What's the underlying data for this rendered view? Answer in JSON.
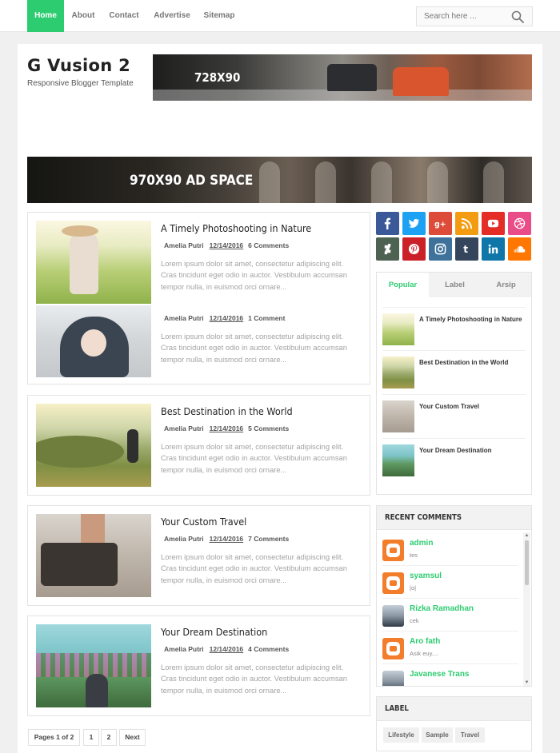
{
  "nav": {
    "items": [
      "Home",
      "About",
      "Contact",
      "Advertise",
      "Sitemap"
    ],
    "active": "Home",
    "search_placeholder": "Search here ..."
  },
  "header": {
    "blog_title": "G Vusion 2",
    "tagline": "Responsive Blogger Template",
    "ad_728": "728X90",
    "ad_970": "970X90 AD SPACE"
  },
  "posts": [
    {
      "title": "A Timely Photoshooting in Nature",
      "author": "Amelia Putri",
      "date": "12/14/2016",
      "comments": "6 Comments",
      "excerpt": "Lorem ipsum dolor sit amet, consectetur adipiscing elit. Cras tincidunt eget odio in auctor. Vestibulum accumsan tempor nulla, in euismod orci ornare...",
      "image": "nature-photoshoot"
    },
    {
      "title": "",
      "author": "Amelia Putri",
      "date": "12/14/2016",
      "comments": "1 Comment",
      "excerpt": "Lorem ipsum dolor sit amet, consectetur adipiscing elit. Cras tincidunt eget odio in auctor. Vestibulum accumsan tempor nulla, in euismod orci ornare...",
      "image": "winter-portrait"
    },
    {
      "title": "Best Destination in the World",
      "author": "Amelia Putri",
      "date": "12/14/2016",
      "comments": "5 Comments",
      "excerpt": "Lorem ipsum dolor sit amet, consectetur adipiscing elit. Cras tincidunt eget odio in auctor. Vestibulum accumsan tempor nulla, in euismod orci ornare...",
      "image": "mountain-hiker"
    },
    {
      "title": "Your Custom Travel",
      "author": "Amelia Putri",
      "date": "12/14/2016",
      "comments": "7 Comments",
      "excerpt": "Lorem ipsum dolor sit amet, consectetur adipiscing elit. Cras tincidunt eget odio in auctor. Vestibulum accumsan tempor nulla, in euismod orci ornare...",
      "image": "suitcase"
    },
    {
      "title": "Your Dream Destination",
      "author": "Amelia Putri",
      "date": "12/14/2016",
      "comments": "4 Comments",
      "excerpt": "Lorem ipsum dolor sit amet, consectetur adipiscing elit. Cras tincidunt eget odio in auctor. Vestibulum accumsan tempor nulla, in euismod orci ornare...",
      "image": "flower-field"
    }
  ],
  "pagination": {
    "label": "Pages 1 of 2",
    "pages": [
      "1",
      "2"
    ],
    "next": "Next"
  },
  "social": [
    {
      "name": "facebook-icon",
      "color": "#3b5998"
    },
    {
      "name": "twitter-icon",
      "color": "#1da1f2"
    },
    {
      "name": "google-plus-icon",
      "color": "#dd4b39"
    },
    {
      "name": "rss-icon",
      "color": "#f39c12"
    },
    {
      "name": "youtube-icon",
      "color": "#e52d27"
    },
    {
      "name": "dribbble-icon",
      "color": "#ea4c89"
    },
    {
      "name": "deviantart-icon",
      "color": "#4e6252"
    },
    {
      "name": "pinterest-icon",
      "color": "#cb2027"
    },
    {
      "name": "instagram-icon",
      "color": "#3f729b"
    },
    {
      "name": "tumblr-icon",
      "color": "#35465c"
    },
    {
      "name": "linkedin-icon",
      "color": "#0e76a8"
    },
    {
      "name": "soundcloud-icon",
      "color": "#ff7700"
    }
  ],
  "popular_widget": {
    "tabs": [
      "Popular",
      "Label",
      "Arsip"
    ],
    "active_tab": "Popular",
    "items": [
      "A Timely Photoshooting in Nature",
      "Best Destination in the World",
      "Your Custom Travel",
      "Your Dream Destination"
    ]
  },
  "recent_comments": {
    "heading": "RECENT COMMENTS",
    "items": [
      {
        "name": "admin",
        "text": "tes"
      },
      {
        "name": "syamsul",
        "text": "|o|"
      },
      {
        "name": "Rizka Ramadhan",
        "text": "cek"
      },
      {
        "name": "Aro fath",
        "text": "Asik euy...."
      },
      {
        "name": "Javanese Trans",
        "text": ""
      }
    ]
  },
  "labels": {
    "heading": "LABEL",
    "tags": [
      "Lifestyle",
      "Sample",
      "Travel"
    ]
  },
  "colors": {
    "accent": "#2ecc71",
    "background": "#f0f0f0"
  }
}
